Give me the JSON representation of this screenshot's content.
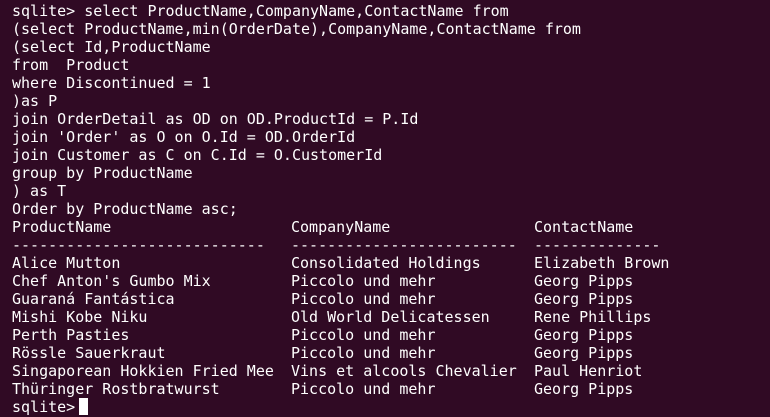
{
  "terminal": {
    "prompt": "sqlite>",
    "query_lines": [
      "sqlite> select ProductName,CompanyName,ContactName from",
      "(select ProductName,min(OrderDate),CompanyName,ContactName from",
      "(select Id,ProductName",
      "from  Product",
      "where Discontinued = 1",
      ")as P",
      "join OrderDetail as OD on OD.ProductId = P.Id",
      "join 'Order' as O on O.Id = OD.OrderId",
      "join Customer as C on C.Id = O.CustomerId",
      "group by ProductName",
      ") as T",
      "Order by ProductName asc;"
    ],
    "result": {
      "headers": [
        "ProductName",
        "CompanyName",
        "ContactName"
      ],
      "separators": [
        "----------------------------",
        "-------------------------",
        "--------------"
      ],
      "rows": [
        [
          "Alice Mutton",
          "Consolidated Holdings",
          "Elizabeth Brown"
        ],
        [
          "Chef Anton's Gumbo Mix",
          "Piccolo und mehr",
          "Georg Pipps"
        ],
        [
          "Guaraná Fantástica",
          "Piccolo und mehr",
          "Georg Pipps"
        ],
        [
          "Mishi Kobe Niku",
          "Old World Delicatessen",
          "Rene Phillips"
        ],
        [
          "Perth Pasties",
          "Piccolo und mehr",
          "Georg Pipps"
        ],
        [
          "Rössle Sauerkraut",
          "Piccolo und mehr",
          "Georg Pipps"
        ],
        [
          "Singaporean Hokkien Fried Mee",
          "Vins et alcools Chevalier",
          "Paul Henriot"
        ],
        [
          "Thüringer Rostbratwurst",
          "Piccolo und mehr",
          "Georg Pipps"
        ]
      ]
    },
    "colors": {
      "background": "#300a24",
      "text": "#ffffff"
    }
  }
}
